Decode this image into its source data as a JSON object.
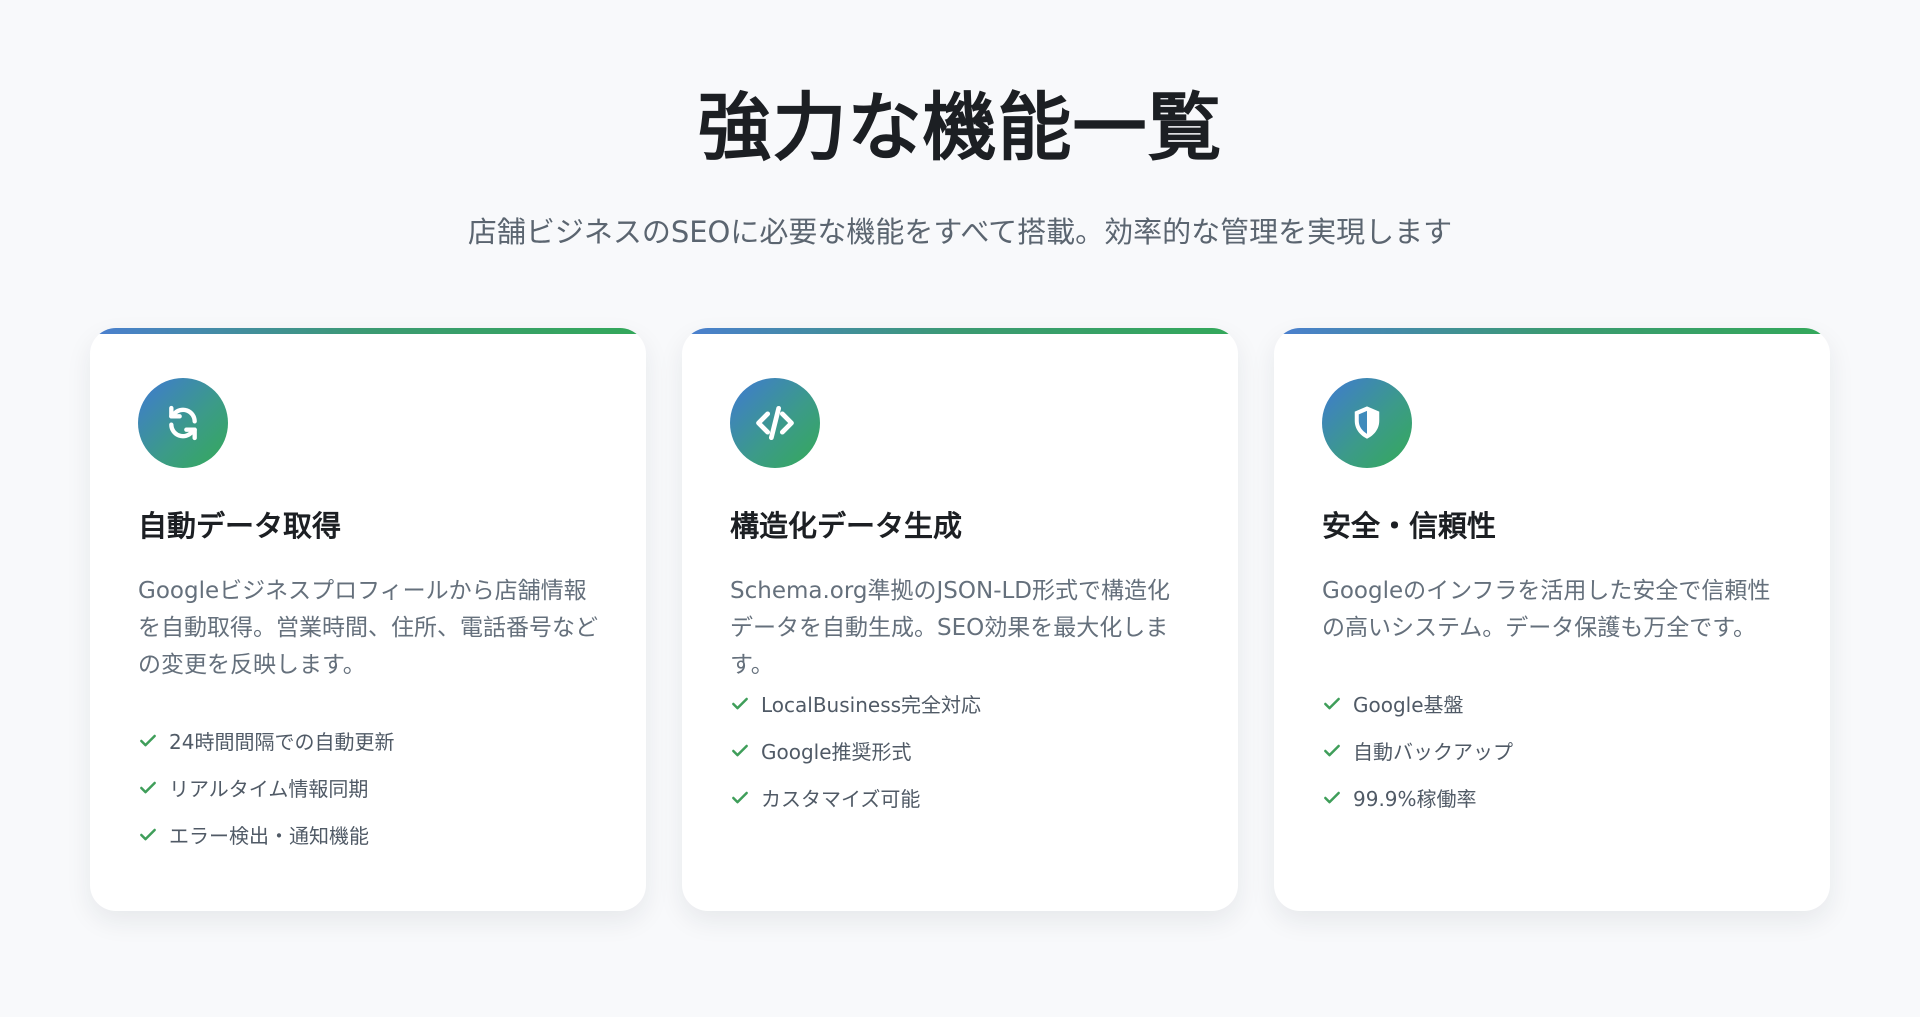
{
  "page": {
    "title": "強力な機能一覧",
    "subtitle": "店舗ビジネスのSEOに必要な機能をすべて搭載。効率的な管理を実現します"
  },
  "colors": {
    "background": "#f8f9fb",
    "card_background": "#ffffff",
    "accent_blue": "#3f79d4",
    "accent_green": "#34aa58",
    "check_green": "#3f9e5a",
    "text_dark": "#1c1f23",
    "text_muted": "#65707c"
  },
  "cards": [
    {
      "icon": "sync-icon",
      "title": "自動データ取得",
      "description": "Googleビジネスプロフィールから店舗情報を自動取得。営業時間、住所、電話番号などの変更を反映します。",
      "features": [
        "24時間間隔での自動更新",
        "リアルタイム情報同期",
        "エラー検出・通知機能"
      ]
    },
    {
      "icon": "code-icon",
      "title": "構造化データ生成",
      "description": "Schema.org準拠のJSON-LD形式で構造化データを自動生成。SEO効果を最大化します。",
      "features": [
        "LocalBusiness完全対応",
        "Google推奨形式",
        "カスタマイズ可能"
      ]
    },
    {
      "icon": "shield-icon",
      "title": "安全・信頼性",
      "description": "Googleのインフラを活用した安全で信頼性の高いシステム。データ保護も万全です。",
      "features": [
        "Google基盤",
        "自動バックアップ",
        "99.9%稼働率"
      ]
    }
  ]
}
